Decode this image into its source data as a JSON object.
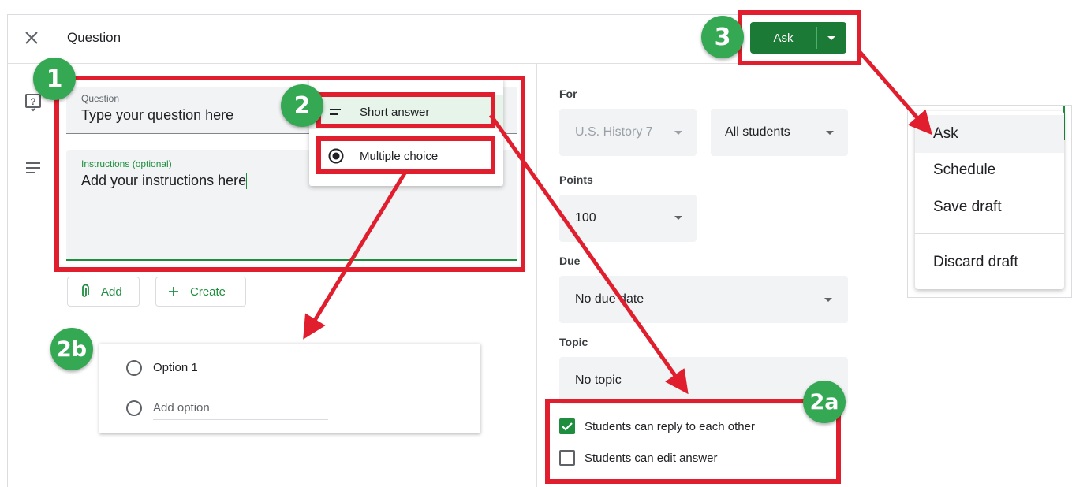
{
  "dialog": {
    "title": "Question",
    "close_icon": "close-icon"
  },
  "question": {
    "label": "Question",
    "placeholder": "Type your question here"
  },
  "instructions": {
    "label": "Instructions (optional)",
    "placeholder": "Add your instructions here"
  },
  "attach": {
    "add_label": "Add",
    "create_label": "Create"
  },
  "type_menu": {
    "items": [
      {
        "label": "Short answer",
        "icon": "short-text-icon",
        "selected": true
      },
      {
        "label": "Multiple choice",
        "icon": "radio-checked-icon",
        "selected": false
      }
    ]
  },
  "options": {
    "option1": "Option 1",
    "add_option": "Add option"
  },
  "sidebar": {
    "for_label": "For",
    "class_value": "U.S. History 7",
    "students_value": "All students",
    "points_label": "Points",
    "points_value": "100",
    "due_label": "Due",
    "due_value": "No due date",
    "topic_label": "Topic",
    "topic_value": "No topic",
    "reply_label": "Students can reply to each other",
    "reply_checked": true,
    "edit_label": "Students can edit answer",
    "edit_checked": false
  },
  "ask_button": {
    "label": "Ask"
  },
  "ask_menu": {
    "items": [
      "Ask",
      "Schedule",
      "Save draft",
      "Discard draft"
    ]
  },
  "annotations": {
    "badge_1": "1",
    "badge_2": "2",
    "badge_2a": "2a",
    "badge_2b": "2b",
    "badge_3": "3"
  },
  "colors": {
    "accent_green": "#1e8e3e",
    "button_green": "#1b7a36",
    "annotation_red": "#e01e2e",
    "badge_green": "#34a853"
  }
}
